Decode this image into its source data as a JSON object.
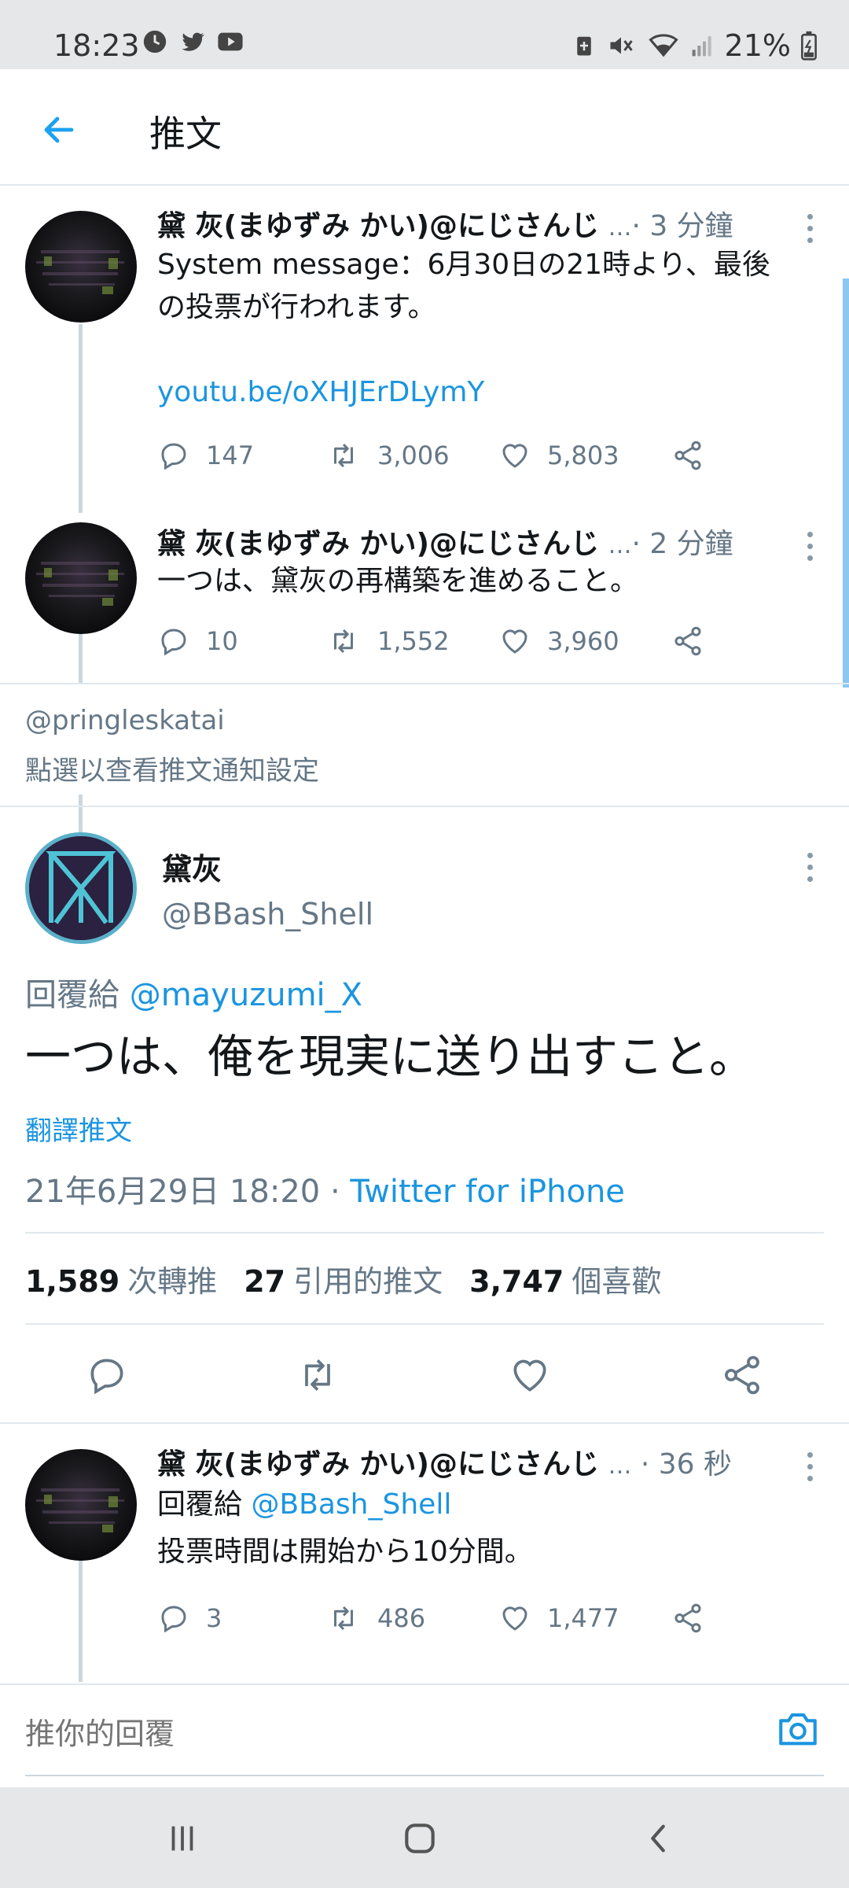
{
  "status_bar": {
    "time": "18:23",
    "battery": "21%",
    "icons": [
      "clock-icon",
      "twitter-icon",
      "youtube-icon",
      "battery-saver-icon",
      "mute-icon",
      "wifi-icon",
      "signal-icon",
      "battery-icon"
    ]
  },
  "app_bar": {
    "title": "推文",
    "back_icon": "arrow-left-icon"
  },
  "thread": [
    {
      "name": "黛 灰(まゆずみ かい)@にじさんじ",
      "ellipsis": "…",
      "time": "· 3 分鐘",
      "text_lines": [
        "System message：6月30日の21時より、最後",
        "の投票が行われます。"
      ],
      "link": "youtu.be/oXHJErDLymY",
      "replies": "147",
      "retweets": "3,006",
      "likes": "5,803"
    },
    {
      "name": "黛 灰(まゆずみ かい)@にじさんじ",
      "ellipsis": "…",
      "time": "· 2 分鐘",
      "text_lines": [
        "一つは、黛灰の再構築を進めること。"
      ],
      "replies": "10",
      "retweets": "1,552",
      "likes": "3,960"
    }
  ],
  "notice": {
    "handle": "@pringleskatai",
    "text": "點選以查看推文通知設定"
  },
  "main_tweet": {
    "name": "黛灰",
    "handle": "@BBash_Shell",
    "reply_prefix": "回覆給",
    "reply_to": "@mayuzumi_X",
    "text": "一つは、俺を現実に送り出すこと。",
    "translate": "翻譯推文",
    "date": "21年6月29日 18:20 · ",
    "source": "Twitter for iPhone",
    "retweet_count": "1,589",
    "retweet_label": "次轉推",
    "quote_count": "27",
    "quote_label": "引用的推文",
    "like_count": "3,747",
    "like_label": "個喜歡"
  },
  "reply_tweet": {
    "name": "黛 灰(まゆずみ かい)@にじさんじ",
    "ellipsis": "…",
    "time": "· 36 秒",
    "reply_prefix": "回覆給",
    "reply_to": "@BBash_Shell",
    "text": "投票時間は開始から10分間。",
    "replies": "3",
    "retweets": "486",
    "likes": "1,477"
  },
  "reply_bar": {
    "placeholder": "推你的回覆"
  },
  "colors": {
    "accent": "#1b95e0",
    "secondary_text": "#657786",
    "divider": "#e1e8ed"
  }
}
